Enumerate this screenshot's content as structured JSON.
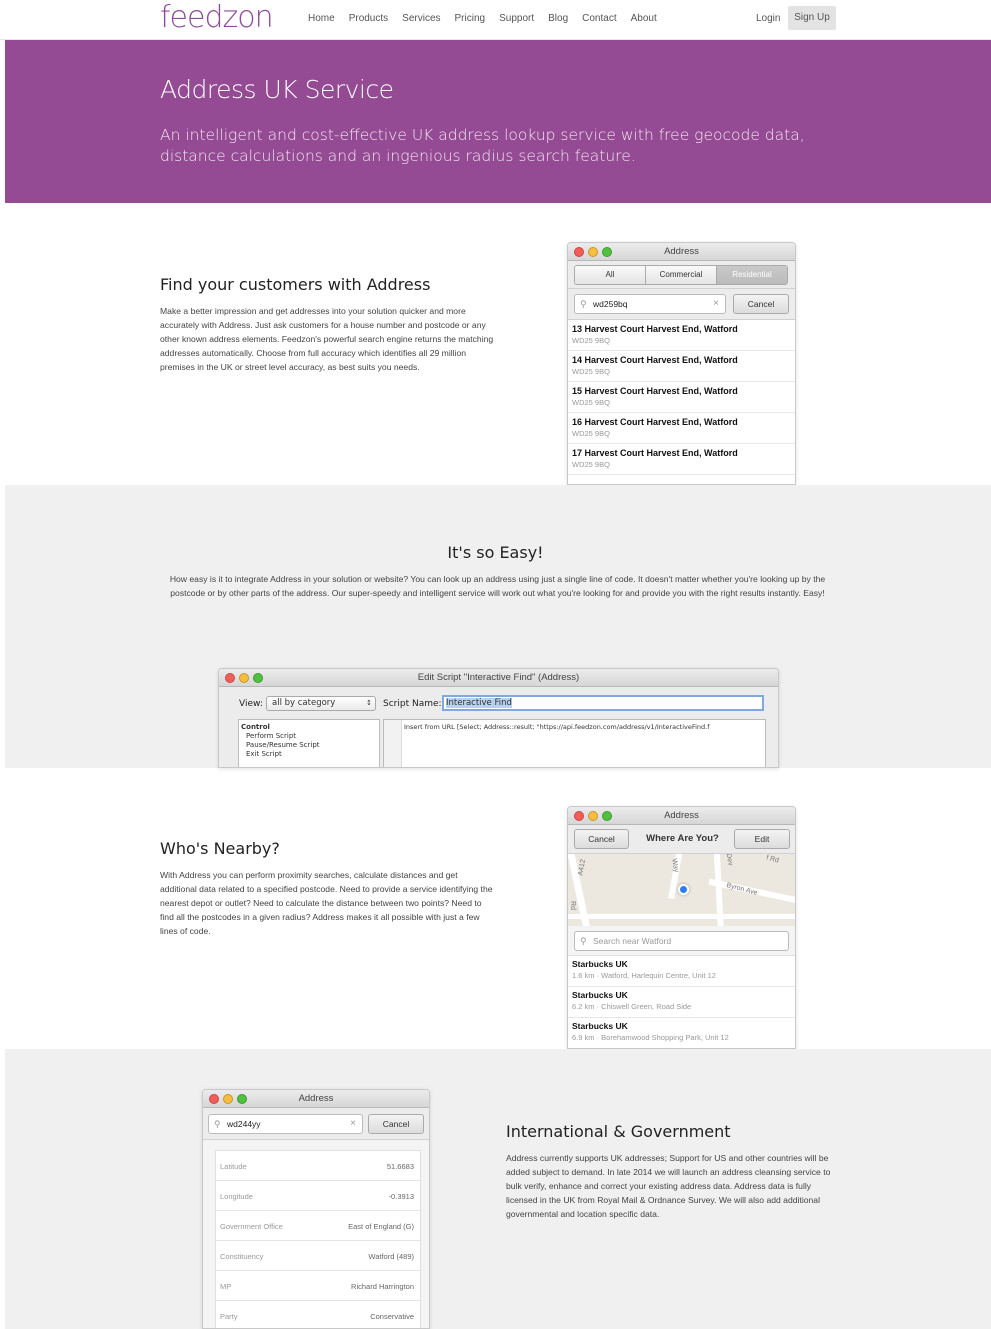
{
  "nav": {
    "logo": "feedzon",
    "links": [
      "Home",
      "Products",
      "Services",
      "Pricing",
      "Support",
      "Blog",
      "Contact",
      "About"
    ],
    "login": "Login",
    "signup": "Sign Up"
  },
  "hero": {
    "title": "Address UK Service",
    "subtitle": "An intelligent and cost-effective UK address lookup service with free geocode data, distance calculations and an ingenious radius search feature."
  },
  "find": {
    "title": "Find your customers with Address",
    "text": "Make a better impression and get addresses into your solution quicker and more accurately with Address. Just ask customers for a house number and postcode or any other known address elements. Feedzon's powerful search engine returns the matching addresses automatically. Choose from full accuracy which identifies all 29 million premises in the UK or street level accuracy, as best suits you needs.",
    "window": {
      "title": "Address",
      "tabs": [
        "All",
        "Commercial",
        "Residential"
      ],
      "search_value": "wd259bq",
      "cancel": "Cancel",
      "results": [
        {
          "title": "13 Harvest Court Harvest End, Watford",
          "sub": "WD25 9BQ"
        },
        {
          "title": "14 Harvest Court Harvest End, Watford",
          "sub": "WD25 9BQ"
        },
        {
          "title": "15 Harvest Court Harvest End, Watford",
          "sub": "WD25 9BQ"
        },
        {
          "title": "16 Harvest Court Harvest End, Watford",
          "sub": "WD25 9BQ"
        },
        {
          "title": "17 Harvest Court Harvest End, Watford",
          "sub": "WD25 9BQ"
        }
      ]
    }
  },
  "easy": {
    "title": "It's so Easy!",
    "text": "How easy is it to integrate Address in your solution or website? You can look up an address using just a single line of code. It doesn't matter whether you're looking up by the postcode or by other parts of the address. Our super-speedy and intelligent service will work out what you're looking for and provide you with the right results instantly. Easy!",
    "window": {
      "title": "Edit Script \"Interactive Find\" (Address)",
      "view_label": "View:",
      "view_value": "all by category",
      "script_name_label": "Script Name:",
      "script_name_value": "Interactive Find",
      "steps_header": "Control",
      "steps": [
        "Perform Script",
        "Pause/Resume Script",
        "Exit Script"
      ],
      "code": "Insert from URL [Select; Address::result; \"https://api.feedzon.com/address/v1/InteractiveFind.f"
    }
  },
  "nearby": {
    "title": "Who's Nearby?",
    "text": "With Address you can perform proximity searches, calculate distances and get additional data related to a specified postcode. Need to provide a service identifying the nearest depot or outlet? Need to calculate the distance between two points? Need to find all the postcodes in a given radius? Address makes it all possible with just a few lines of code.",
    "window": {
      "title": "Address",
      "cancel": "Cancel",
      "heading": "Where Are You?",
      "edit": "Edit",
      "map_labels": [
        "A412",
        "Way",
        "Dev",
        "f Rd",
        "Byron Ave",
        "Rd"
      ],
      "search_placeholder": "Search near Watford",
      "results": [
        {
          "title": "Starbucks UK",
          "sub": "1.6 km · Watford, Harlequin Centre, Unit 12"
        },
        {
          "title": "Starbucks UK",
          "sub": "6.2 km · Chiswell Green, Road Side"
        },
        {
          "title": "Starbucks UK",
          "sub": "6.9 km · Borehamwood Shopping Park, Unit 12"
        }
      ]
    }
  },
  "intl": {
    "title": "International & Government",
    "text": "Address currently supports UK addresses; Support for US and other countries will be added subject to demand. In late 2014 we will launch an address cleansing service to bulk verify, enhance and correct your existing address data. Address data is fully licensed in the UK from Royal Mail & Ordnance Survey. We will also add additional governmental and location specific data.",
    "window": {
      "title": "Address",
      "search_value": "wd244yy",
      "cancel": "Cancel",
      "rows": [
        {
          "k": "Latitude",
          "v": "51.6683"
        },
        {
          "k": "Longitude",
          "v": "-0.3913"
        },
        {
          "k": "Government Office",
          "v": "East of England (G)"
        },
        {
          "k": "Constituency",
          "v": "Watford (489)"
        },
        {
          "k": "MP",
          "v": "Richard Harrington"
        },
        {
          "k": "Party",
          "v": "Conservative"
        }
      ]
    }
  }
}
